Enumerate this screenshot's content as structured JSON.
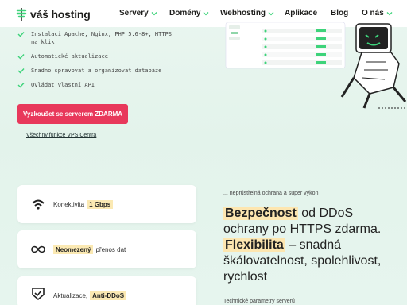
{
  "header": {
    "logo_text": "váš hosting",
    "nav": [
      {
        "label": "Servery",
        "dropdown": true
      },
      {
        "label": "Domény",
        "dropdown": true
      },
      {
        "label": "Webhosting",
        "dropdown": true
      },
      {
        "label": "Aplikace",
        "dropdown": false
      },
      {
        "label": "Blog",
        "dropdown": false
      },
      {
        "label": "O nás",
        "dropdown": true
      }
    ]
  },
  "features": [
    "Instalaci Apache, Nginx, PHP 5.6-8+, HTTPS",
    "na klik",
    "Automatické aktualizace",
    "Snadno spravovat a organizovat databáze",
    "Ovládat vlastní API"
  ],
  "cta": {
    "label": "Vyzkoušet se serverem ZDARMA"
  },
  "link": {
    "label": "Všechny funkce VPS Centra"
  },
  "cards": [
    {
      "prefix": "Konektivita",
      "highlight": "1 Gbps",
      "suffix": "",
      "icon": "wifi-icon"
    },
    {
      "prefix": "",
      "highlight": "Neomezený",
      "suffix": "přenos dat",
      "icon": "infinity-icon"
    },
    {
      "prefix": "Aktualizace,",
      "highlight": "Anti-DDoS",
      "suffix": "",
      "icon": "shield-icon"
    }
  ],
  "promo": {
    "subhead": "... neprůstřelná ochrana a super výkon",
    "kw1": "Bezpečnost",
    "text1": " od DDoS ochrany po HTTPS zdarma. ",
    "kw2": "Flexibilita",
    "text2": " – snadná škálovatelnost, spolehlivost, rychlost",
    "bottom": "Technické parametry serverů"
  },
  "colors": {
    "accent": "#e8385b",
    "brand_green": "#3dd37a",
    "highlight": "#fde6b0"
  }
}
